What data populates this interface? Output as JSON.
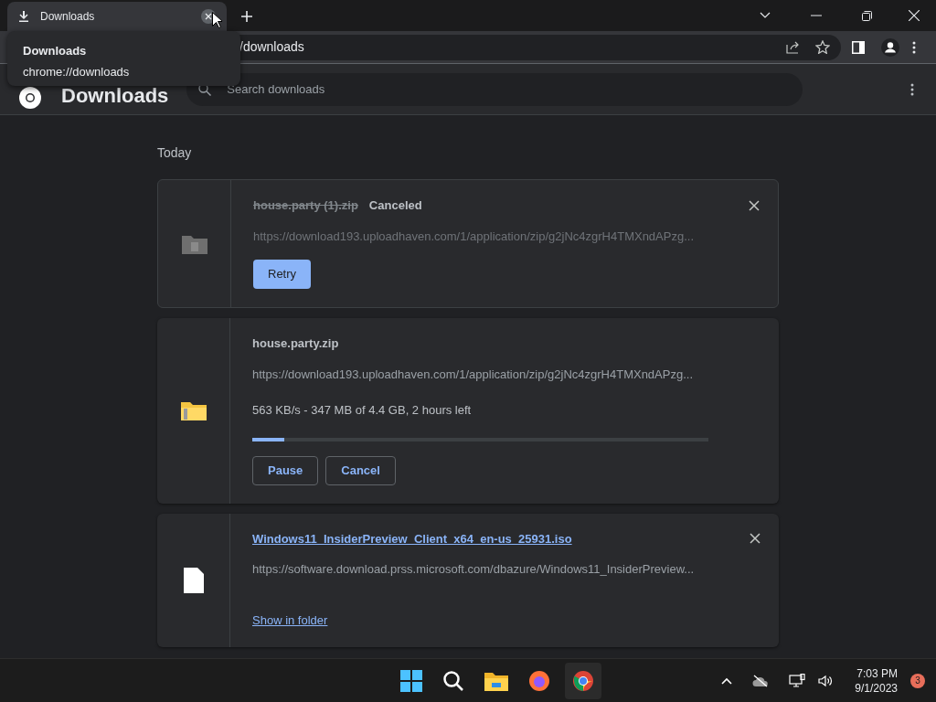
{
  "tab": {
    "title": "Downloads",
    "selected": true
  },
  "tooltip": {
    "title": "Downloads",
    "url": "chrome://downloads"
  },
  "omnibox": {
    "text": "/downloads"
  },
  "header": {
    "title": "Downloads",
    "search_placeholder": "Search downloads"
  },
  "section": "Today",
  "downloads": [
    {
      "kind": "canceled",
      "file_name": "house.party (1).zip",
      "status": "Canceled",
      "url": "https://download193.uploadhaven.com/1/application/zip/g2jNc4zgrH4TMXndAPzg...",
      "buttons": [
        {
          "label": "Retry",
          "kind": "primary"
        }
      ]
    },
    {
      "kind": "in_progress",
      "file_name": "house.party.zip",
      "url": "https://download193.uploadhaven.com/1/application/zip/g2jNc4zgrH4TMXndAPzg...",
      "progress_text": "563 KB/s - 347 MB of 4.4 GB, 2 hours left",
      "level": 0.07,
      "buttons": [
        {
          "label": "Pause",
          "kind": "outline"
        },
        {
          "label": "Cancel",
          "kind": "outline"
        }
      ]
    },
    {
      "kind": "complete",
      "file_name": "Windows11_InsiderPreview_Client_x64_en-us_25931.iso",
      "url": "https://software.download.prss.microsoft.com/dbazure/Windows11_InsiderPreview...",
      "buttons": [
        {
          "label": "Show in folder",
          "kind": "link"
        }
      ]
    }
  ],
  "taskbar": {
    "time": "7:03 PM",
    "date": "9/1/2023",
    "notifications": "3"
  }
}
